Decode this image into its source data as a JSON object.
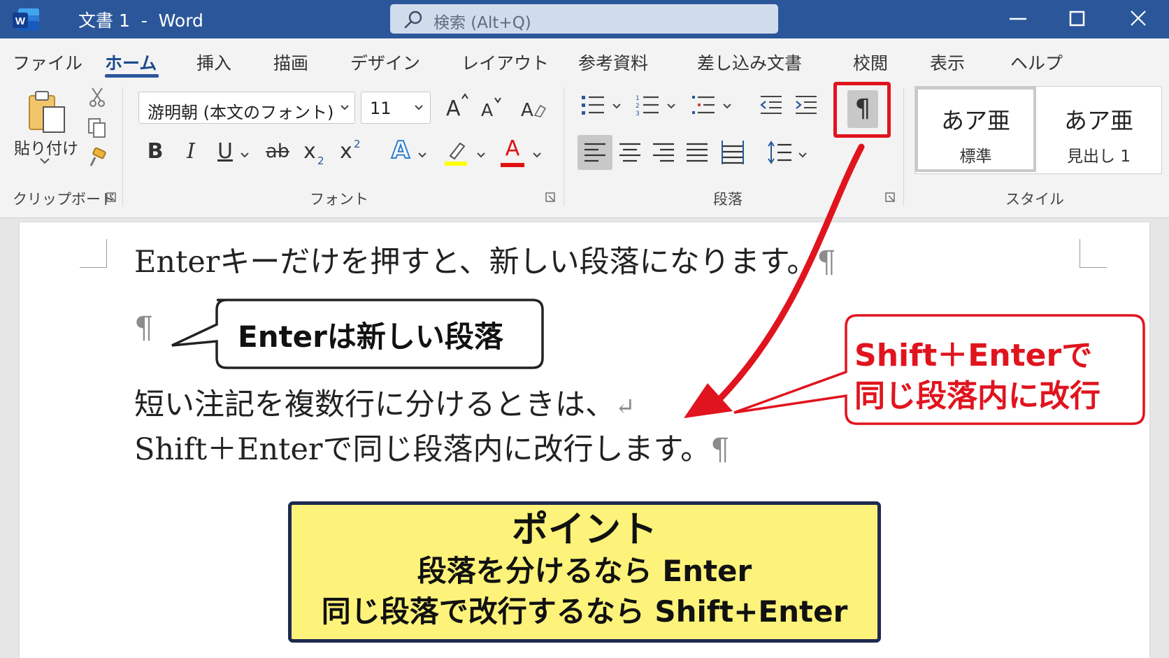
{
  "titlebar": {
    "app_icon": "word-logo",
    "doc_title": "文書 1  -  Word",
    "search_placeholder": "検索 (Alt+Q)",
    "bg_color": "#2b579a"
  },
  "menu": {
    "tabs": [
      "ファイル",
      "ホーム",
      "挿入",
      "描画",
      "デザイン",
      "レイアウト",
      "参考資料",
      "差し込み文書",
      "校閲",
      "表示",
      "ヘルプ"
    ],
    "active_tab": "ホーム"
  },
  "ribbon": {
    "clipboard": {
      "paste_label": "貼り付け",
      "group_label": "クリップボード"
    },
    "font": {
      "font_name": "游明朝 (本文のフォント)",
      "font_size": "11",
      "group_label": "フォント",
      "bold": "B",
      "italic": "I",
      "underline": "U",
      "strike": "ab",
      "subscript": "x",
      "subscript_mark": "2",
      "superscript": "x",
      "superscript_mark": "2",
      "text_effect": "A",
      "highlight_color": "#ffff00",
      "font_color_letter": "A",
      "font_color": "#e01010"
    },
    "paragraph": {
      "group_label": "段落",
      "show_marks_glyph": "¶"
    },
    "styles": {
      "group_label": "スタイル",
      "items": [
        {
          "sample": "あア亜",
          "name": "標準"
        },
        {
          "sample": "あア亜",
          "name": "見出し 1"
        }
      ]
    }
  },
  "document": {
    "line1": "Enterキーだけを押すと、新しい段落になります。",
    "pilcrow": "¶",
    "line3": "短い注記を複数行に分けるときは、",
    "return_mark": "↵",
    "line4": "Shift＋Enterで同じ段落内に改行します。"
  },
  "annotations": {
    "callout_enter": "Enterは新しい段落",
    "callout_shift_line1": "Shift＋Enterで",
    "callout_shift_line2": "同じ段落内に改行",
    "point_title": "ポイント",
    "point_line1": "段落を分けるなら Enter",
    "point_line2": "同じ段落で改行するなら Shift+Enter",
    "accent_red": "#e0141e",
    "point_bg": "#fdf37a",
    "point_border": "#1f2a4f"
  }
}
